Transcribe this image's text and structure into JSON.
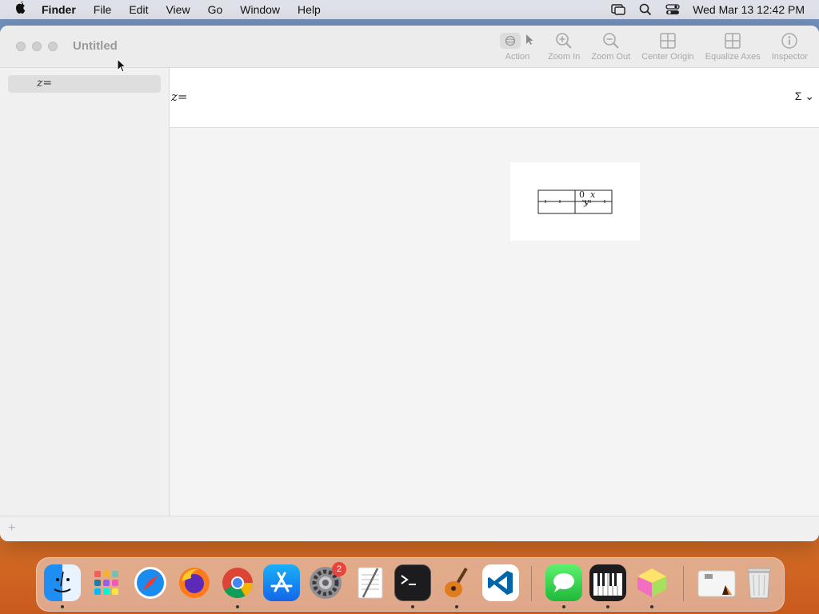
{
  "menubar": {
    "app": "Finder",
    "items": [
      "File",
      "Edit",
      "View",
      "Go",
      "Window",
      "Help"
    ],
    "clock": "Wed Mar 13  12:42 PM"
  },
  "window": {
    "title": "Untitled",
    "toolbar": {
      "action": "Action",
      "zoom_in": "Zoom In",
      "zoom_out": "Zoom Out",
      "center_origin": "Center Origin",
      "equalize_axes": "Equalize Axes",
      "inspector": "Inspector"
    },
    "sidebar": {
      "equation_item": "z="
    },
    "equation": {
      "label": "z=",
      "sigma": "Σ ⌄"
    },
    "plot": {
      "tick_zero": "0",
      "axis_x": "x",
      "axis_y": "y"
    }
  },
  "dock": {
    "apps": [
      "Finder",
      "Launchpad",
      "Safari",
      "Firefox",
      "Chrome",
      "App Store",
      "System Settings",
      "TextEdit",
      "Terminal",
      "GarageBand",
      "Visual Studio Code",
      "Messages",
      "Piano",
      "Grapher",
      "Downloads",
      "Trash"
    ],
    "settings_badge": "2"
  },
  "colors": {
    "accent": "#3a7df5",
    "badge": "#e8443a"
  }
}
